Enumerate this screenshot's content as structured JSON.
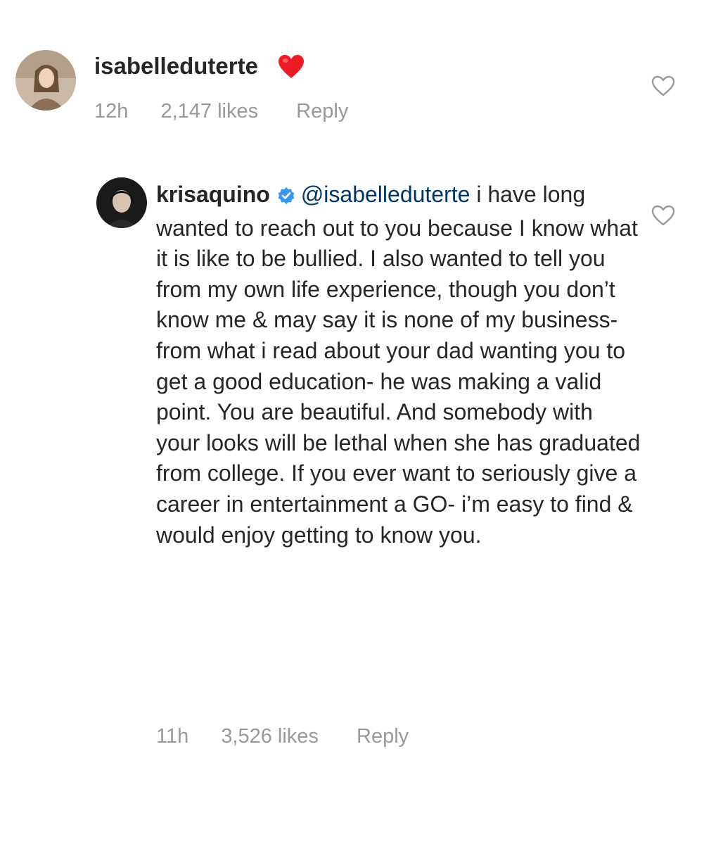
{
  "comments": [
    {
      "username": "isabelleduterte",
      "text": "",
      "emoji": "red-heart",
      "time": "12h",
      "likes": "2,147 likes",
      "reply": "Reply"
    },
    {
      "username": "krisaquino",
      "verified": true,
      "mention": "@isabelleduterte",
      "text": " i have long wanted to reach out to you because I know what it is like to be bullied. I also wanted to tell you from my own life experience, though you don’t know me & may say it is none of my business- from what i read about your dad wanting you to get a good education- he was making a valid point. You are beautiful. And somebody with your looks will be lethal when she has graduated from college. If you ever want to seriously give a career in entertainment a GO- i’m easy to find & would enjoy getting to know you.",
      "time": "11h",
      "likes": "3,526 likes",
      "reply": "Reply"
    }
  ],
  "icons": {
    "like": "heart-outline-icon",
    "emoji": "red-heart-emoji",
    "verified": "verified-badge-icon"
  },
  "colors": {
    "text": "#262626",
    "meta": "#999999",
    "mention": "#003569",
    "verified": "#3897f0",
    "heart": "#ed1c24"
  }
}
